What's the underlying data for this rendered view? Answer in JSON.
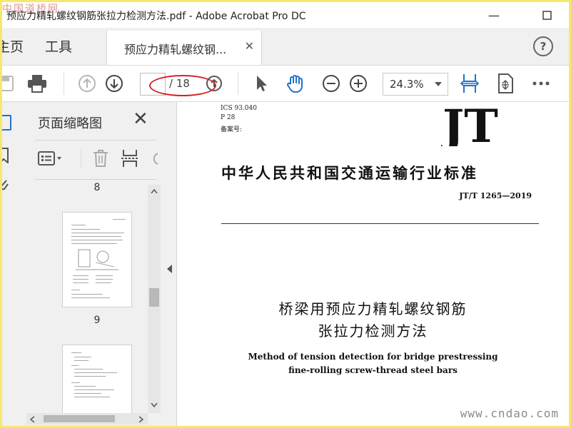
{
  "watermark": {
    "top_left": "中国道桥网",
    "bottom_right": "www.cndao.com"
  },
  "window": {
    "title": "预应力精轧螺纹钢筋张拉力检测方法.pdf - Adobe Acrobat Pro DC"
  },
  "menu": {
    "home_label": "主页",
    "tools_label": "工具",
    "doc_tab_label": "预应力精轧螺纹钢...",
    "help": "?"
  },
  "toolbar": {
    "page_current": "",
    "page_total": "/ 18",
    "zoom": "24.3%"
  },
  "panel": {
    "title": "页面缩略图",
    "thumbs": [
      {
        "label": "8"
      },
      {
        "label": "9"
      }
    ]
  },
  "document": {
    "logo_text": "JT",
    "ics": "ICS 93.040",
    "class_code": "P 28",
    "filing_label": "备案号:",
    "title": "中华人民共和国交通运输行业标准",
    "code": "JT/T 1265—2019",
    "cn_title_line1": "桥梁用预应力精轧螺纹钢筋",
    "cn_title_line2": "张拉力检测方法",
    "en_title_line1": "Method of tension detection for bridge prestressing",
    "en_title_line2": "fine-rolling screw-thread steel bars"
  },
  "colors": {
    "annotation_red": "#d62222",
    "hand_tool_blue": "#1f73c8",
    "watermark_red": "#be3c3c"
  }
}
